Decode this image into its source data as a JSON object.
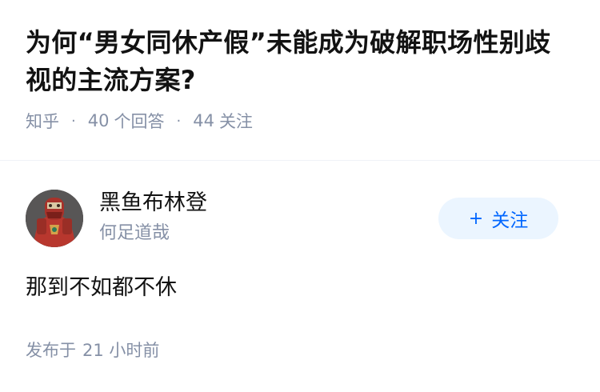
{
  "question": {
    "title": "为何“男女同休产假”未能成为破解职场性别歧视的主流方案?",
    "source": "知乎",
    "answer_count": "40",
    "answer_label": "个回答",
    "follow_count": "44",
    "follow_label": "关注"
  },
  "answer": {
    "author": {
      "name": "黑鱼布林登",
      "bio": "何足道哉",
      "avatar_icon": "avatar-image"
    },
    "follow_button": {
      "icon": "plus-icon",
      "plus": "+",
      "label": "关注"
    },
    "content": "那到不如都不休",
    "published_label": "发布于",
    "published_time": "21 小时前"
  },
  "colors": {
    "accent": "#0066ff",
    "accent_bg": "#ebf5ff",
    "meta_text": "#8590a6",
    "main_text": "#121212"
  }
}
